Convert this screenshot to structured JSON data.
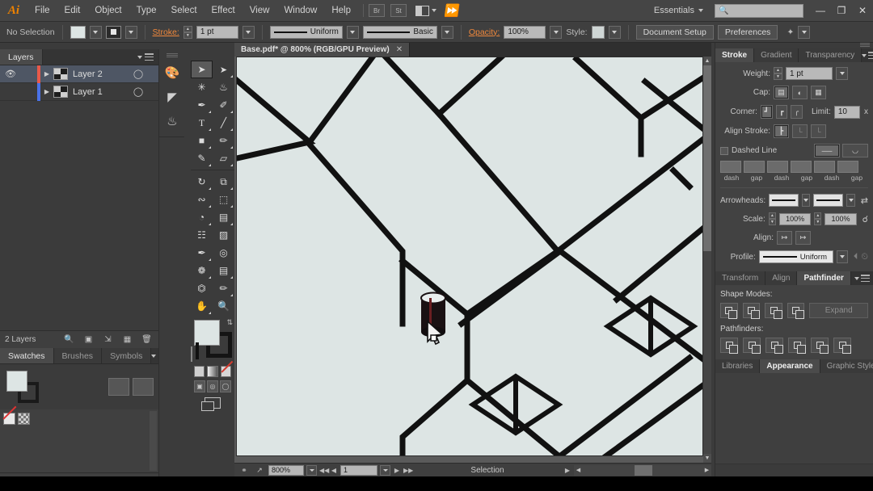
{
  "app": {
    "name": "Adobe Illustrator",
    "logo": "Ai"
  },
  "menubar": {
    "items": [
      "File",
      "Edit",
      "Object",
      "Type",
      "Select",
      "Effect",
      "View",
      "Window",
      "Help"
    ],
    "bridge_label": "Br",
    "stock_label": "St",
    "arrange_label": "",
    "workspace": "Essentials",
    "search_placeholder": "",
    "search_value": "",
    "icons": {
      "bridge": "bridge-icon",
      "stock": "stock-icon",
      "arrange": "arrange-documents-icon",
      "flag": "illustrator-flag-icon",
      "search": "search-icon",
      "minimize": "minimize-icon",
      "restore": "restore-icon",
      "close": "close-icon"
    },
    "window_buttons": {
      "minimize": "—",
      "restore": "❐",
      "close": "✕"
    }
  },
  "controlbar": {
    "selection_status": "No Selection",
    "stroke_label": "Stroke:",
    "stroke_weight": "1 pt",
    "variable_width_profile": "Uniform",
    "brush_definition": "Basic",
    "opacity_label": "Opacity:",
    "opacity_value": "100%",
    "style_label": "Style:",
    "document_setup_label": "Document Setup",
    "preferences_label": "Preferences",
    "fill_color": "#dde5e4",
    "stroke_color": "#2b2b2b"
  },
  "left_dock": {
    "layers_panel": {
      "tabs": [
        {
          "label": "Layers",
          "active": true
        }
      ],
      "rows": [
        {
          "name": "Layer 2",
          "color": "#e8594a",
          "selected": true,
          "visible": true,
          "locked": false
        },
        {
          "name": "Layer 1",
          "color": "#4a72e8",
          "selected": false,
          "visible": false,
          "locked": false
        }
      ],
      "footer_count": "2 Layers",
      "footer_icons": [
        "locate-object-icon",
        "make-clipping-mask-icon",
        "create-new-sublayer-icon",
        "create-new-layer-icon",
        "delete-selection-icon"
      ]
    },
    "swatches_panel": {
      "tabs": [
        {
          "label": "Swatches",
          "active": true
        },
        {
          "label": "Brushes",
          "active": false
        },
        {
          "label": "Symbols",
          "active": false
        }
      ],
      "fill_color": "#dde5e4",
      "stroke_color": "#1a1a1a",
      "footer_icons": [
        "swatch-libraries-icon",
        "show-color-themes-icon",
        "add-theme-icon",
        "library-menu-icon",
        "show-swatch-kinds-icon",
        "swatch-options-icon",
        "new-color-group-icon",
        "new-swatch-icon",
        "delete-swatch-icon"
      ]
    }
  },
  "icon_dock": {
    "items": [
      {
        "name": "color-panel-icon",
        "glyph": "◑"
      },
      {
        "name": "gradient-panel-icon",
        "glyph": "◥"
      },
      {
        "name": "symbols-panel-icon",
        "glyph": "⚬"
      }
    ]
  },
  "tools": {
    "items": [
      {
        "name": "selection-tool",
        "glyph": "➤",
        "active": true
      },
      {
        "name": "direct-selection-tool",
        "glyph": "➤",
        "active": false
      },
      {
        "name": "magic-wand-tool",
        "glyph": "✳",
        "active": false
      },
      {
        "name": "lasso-tool",
        "glyph": "☙",
        "active": false
      },
      {
        "name": "pen-tool",
        "glyph": "✒",
        "active": false
      },
      {
        "name": "curvature-tool",
        "glyph": "✐",
        "active": false
      },
      {
        "name": "type-tool",
        "glyph": "T",
        "active": false
      },
      {
        "name": "line-segment-tool",
        "glyph": "╱",
        "active": false
      },
      {
        "name": "rectangle-tool",
        "glyph": "■",
        "active": false
      },
      {
        "name": "paintbrush-tool",
        "glyph": "✐",
        "active": false
      },
      {
        "name": "shaper-tool",
        "glyph": "✎",
        "active": false
      },
      {
        "name": "eraser-tool",
        "glyph": "▱",
        "active": false
      },
      {
        "name": "rotate-tool",
        "glyph": "↻",
        "active": false
      },
      {
        "name": "scale-tool",
        "glyph": "⧉",
        "active": false
      },
      {
        "name": "width-tool",
        "glyph": "≈",
        "active": false
      },
      {
        "name": "free-transform-tool",
        "glyph": "⬚",
        "active": false
      },
      {
        "name": "shape-builder-tool",
        "glyph": "◔",
        "active": false
      },
      {
        "name": "perspective-grid-tool",
        "glyph": "▤",
        "active": false
      },
      {
        "name": "mesh-tool",
        "glyph": "⌗",
        "active": false
      },
      {
        "name": "gradient-tool",
        "glyph": "▨",
        "active": false
      },
      {
        "name": "eyedropper-tool",
        "glyph": "✒",
        "active": false
      },
      {
        "name": "blend-tool",
        "glyph": "◎",
        "active": false
      },
      {
        "name": "symbol-sprayer-tool",
        "glyph": "❁",
        "active": false
      },
      {
        "name": "column-graph-tool",
        "glyph": "☰",
        "active": false
      },
      {
        "name": "artboard-tool",
        "glyph": "⛶",
        "active": false
      },
      {
        "name": "slice-tool",
        "glyph": "✄",
        "active": false
      },
      {
        "name": "hand-tool",
        "glyph": "✋",
        "active": false
      },
      {
        "name": "zoom-tool",
        "glyph": "⚲",
        "active": false
      }
    ],
    "fill_color": "#dde5e4",
    "stroke_color": "#141414"
  },
  "document": {
    "tab_title": "Base.pdf* @ 800% (RGB/GPU Preview)",
    "close_glyph": "✕",
    "artboard_fill": "#dde5e4",
    "stroke_color": "#111111"
  },
  "statusbar": {
    "zoom_level": "800%",
    "artboard_number": "1",
    "status_text": "Selection",
    "icons": [
      "fit-artboard-icon",
      "share-icon",
      "first-artboard-icon",
      "previous-artboard-icon",
      "next-artboard-icon",
      "last-artboard-icon"
    ]
  },
  "right_dock": {
    "stroke_panel": {
      "tabs": [
        {
          "label": "Stroke",
          "active": true
        },
        {
          "label": "Gradient",
          "active": false
        },
        {
          "label": "Transparency",
          "active": false
        }
      ],
      "weight_label": "Weight:",
      "weight_value": "1 pt",
      "cap_label": "Cap:",
      "corner_label": "Corner:",
      "limit_label": "Limit:",
      "limit_value": "10",
      "limit_unit": "x",
      "align_stroke_label": "Align Stroke:",
      "dashed_line_label": "Dashed Line",
      "dashed_checked": false,
      "dash_fields": [
        "",
        "",
        "",
        "",
        "",
        ""
      ],
      "dash_labels": [
        "dash",
        "gap",
        "dash",
        "gap",
        "dash",
        "gap"
      ],
      "arrowheads_label": "Arrowheads:",
      "scale_label": "Scale:",
      "scale_start": "100%",
      "scale_end": "100%",
      "align_label": "Align:",
      "profile_label": "Profile:",
      "profile_value": "Uniform"
    },
    "pathfinder_panel": {
      "tabs": [
        {
          "label": "Transform",
          "active": false
        },
        {
          "label": "Align",
          "active": false
        },
        {
          "label": "Pathfinder",
          "active": true
        }
      ],
      "shape_modes_label": "Shape Modes:",
      "shape_modes": [
        "unite-icon",
        "minus-front-icon",
        "intersect-icon",
        "exclude-icon"
      ],
      "expand_label": "Expand",
      "pathfinders_label": "Pathfinders:",
      "pathfinders": [
        "divide-icon",
        "trim-icon",
        "merge-icon",
        "crop-icon",
        "outline-icon",
        "minus-back-icon"
      ]
    },
    "appearance_panel": {
      "tabs": [
        {
          "label": "Libraries",
          "active": false
        },
        {
          "label": "Appearance",
          "active": true
        },
        {
          "label": "Graphic Styles",
          "active": false
        }
      ]
    }
  }
}
